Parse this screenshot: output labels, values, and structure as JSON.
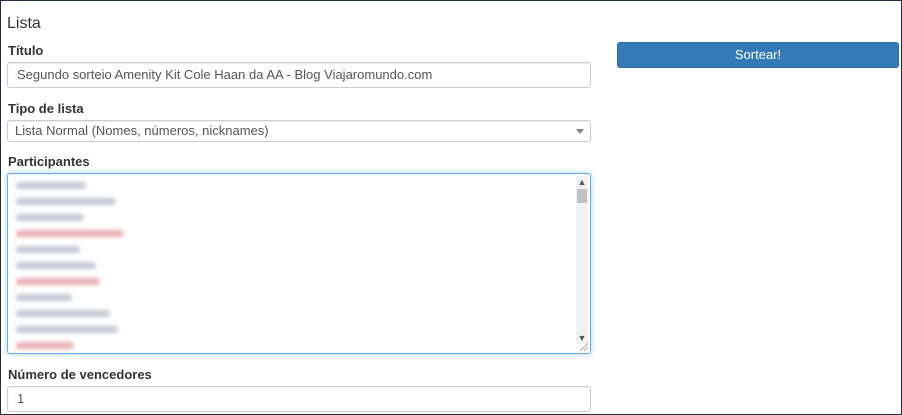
{
  "section_title": "Lista",
  "form": {
    "titulo_label": "Título",
    "titulo_value": "Segundo sorteio Amenity Kit Cole Haan da AA - Blog Viajaromundo.com",
    "tipo_label": "Tipo de lista",
    "tipo_selected": "Lista Normal (Nomes, números, nicknames)",
    "participantes_label": "Participantes",
    "vencedores_label": "Número de vencedores",
    "vencedores_value": "1"
  },
  "actions": {
    "sortear_label": "Sortear!"
  },
  "icons": {
    "select": "chevron-down-icon",
    "scroll_up": "scroll-up-icon",
    "scroll_down": "scroll-down-icon",
    "resize": "resize-grip-icon"
  },
  "colors": {
    "primary_button": "#337ab7",
    "focus_border": "#66afe9",
    "frame_border": "#1f2a44"
  }
}
